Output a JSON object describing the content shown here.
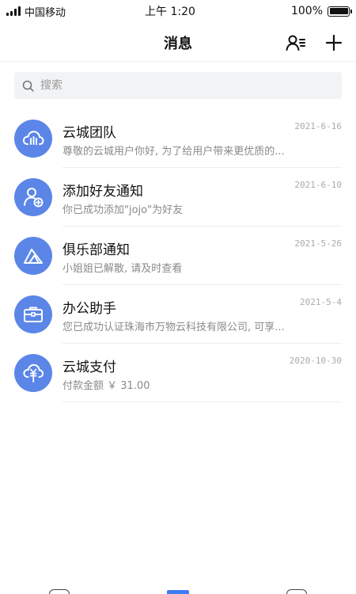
{
  "status_bar": {
    "carrier": "中国移动",
    "time": "上午 1:20",
    "battery": "100%"
  },
  "nav": {
    "title": "消息"
  },
  "search": {
    "placeholder": "搜索"
  },
  "accent_color": "#5b86e8",
  "messages": [
    {
      "icon": "cloud-icon",
      "title": "云城团队",
      "date": "2021-6-16",
      "preview": "尊敬的云城用户你好, 为了给用户带来更优质的..."
    },
    {
      "icon": "add-friend-icon",
      "title": "添加好友通知",
      "date": "2021-6-10",
      "preview": "你已成功添加\"jojo\"为好友"
    },
    {
      "icon": "club-icon",
      "title": "俱乐部通知",
      "date": "2021-5-26",
      "preview": "小姐姐已解散, 请及时查看"
    },
    {
      "icon": "briefcase-icon",
      "title": "办公助手",
      "date": "2021-5-4",
      "preview": "您已成功认证珠海市万物云科技有限公司, 可享..."
    },
    {
      "icon": "yuan-cloud-icon",
      "title": "云城支付",
      "date": "2020-10-30",
      "preview": "付款金额 ￥ 31.00"
    }
  ]
}
